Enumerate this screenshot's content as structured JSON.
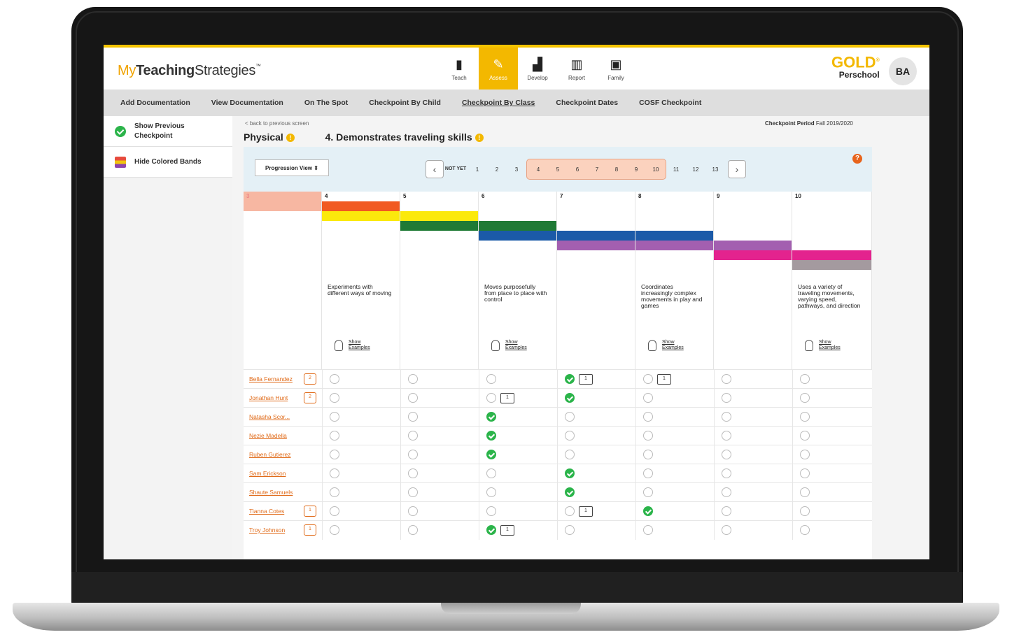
{
  "app": {
    "logo_my": "My",
    "logo_bold": "Teaching",
    "logo_rest": "Strategies",
    "logo_tm": "™"
  },
  "nav": [
    {
      "label": "Teach",
      "icon": "book-icon",
      "glyph": "▮"
    },
    {
      "label": "Assess",
      "icon": "pencil-icon",
      "glyph": "✎",
      "active": true
    },
    {
      "label": "Develop",
      "icon": "stairs-icon",
      "glyph": "▟"
    },
    {
      "label": "Report",
      "icon": "bar-chart-icon",
      "glyph": "▥"
    },
    {
      "label": "Family",
      "icon": "family-icon",
      "glyph": "▣"
    }
  ],
  "brand": {
    "gold": "GOLD",
    "gold_mark": "®",
    "program": "Perschool"
  },
  "user": {
    "initials": "BA"
  },
  "subnav": [
    "Add Documentation",
    "View Documentation",
    "On The Spot",
    "Checkpoint By Child",
    "Checkpoint By Class",
    "Checkpoint Dates",
    "COSF Checkpoint"
  ],
  "subnav_current": "Checkpoint By Class",
  "sidebar": {
    "show_previous": "Show Previous Checkpoint",
    "hide_bands": "Hide Colored Bands"
  },
  "main": {
    "back_link": "< back to previous screen",
    "period_label": "Checkpoint Period",
    "period_value": "Fall 2019/2020",
    "domain": "Physical",
    "objective": "4. Demonstrates traveling skills",
    "view_select": "Progression View"
  },
  "pager": {
    "not_yet": "NOT YET",
    "pages": [
      "1",
      "2",
      "3"
    ],
    "range_pages": [
      "4",
      "5",
      "6",
      "7",
      "8",
      "9",
      "10"
    ],
    "after_pages": [
      "11",
      "12",
      "13"
    ]
  },
  "columns": [
    {
      "num": "3"
    },
    {
      "num": "4",
      "desc": "Experiments with different ways of moving",
      "examples": "Show Examples"
    },
    {
      "num": "5"
    },
    {
      "num": "6",
      "desc": "Moves purposefully from place to place with control",
      "examples": "Show Examples"
    },
    {
      "num": "7"
    },
    {
      "num": "8",
      "desc": "Coordinates increasingly complex movements in play and games",
      "examples": "Show Examples"
    },
    {
      "num": "9"
    },
    {
      "num": "10",
      "desc": "Uses a variety of traveling movements, varying speed, pathways, and direction",
      "examples": "Show Examples"
    }
  ],
  "band_colors": {
    "salmon": "#f7b7a2",
    "orange": "#f15a22",
    "yellow": "#fbe90c",
    "green": "#1f7a35",
    "blue": "#1b5aa8",
    "purple": "#a35fb0",
    "pink": "#e3238e",
    "gray": "#a49a9f"
  },
  "students": [
    {
      "name": "Bella Fernandez",
      "docs": "2",
      "checked": 4,
      "doc_at": [
        4,
        5
      ]
    },
    {
      "name": "Jonathan Hunt",
      "docs": "2",
      "checked": 4,
      "doc_at": [
        3
      ]
    },
    {
      "name": "Natasha Scor...",
      "docs": "",
      "checked": 3,
      "doc_at": []
    },
    {
      "name": "Nezie Madella",
      "docs": "",
      "checked": 3,
      "doc_at": []
    },
    {
      "name": "Ruben Gutierez",
      "docs": "",
      "checked": 3,
      "doc_at": []
    },
    {
      "name": "Sam Erickson",
      "docs": "",
      "checked": 4,
      "doc_at": []
    },
    {
      "name": "Shaute Samuels",
      "docs": "",
      "checked": 4,
      "doc_at": []
    },
    {
      "name": "Tianna Cotes",
      "docs": "1",
      "checked": 5,
      "doc_at": [
        4
      ]
    },
    {
      "name": "Troy Johnson",
      "docs": "1",
      "checked": 3,
      "doc_at": [
        3
      ]
    }
  ],
  "doc_badge": "1"
}
